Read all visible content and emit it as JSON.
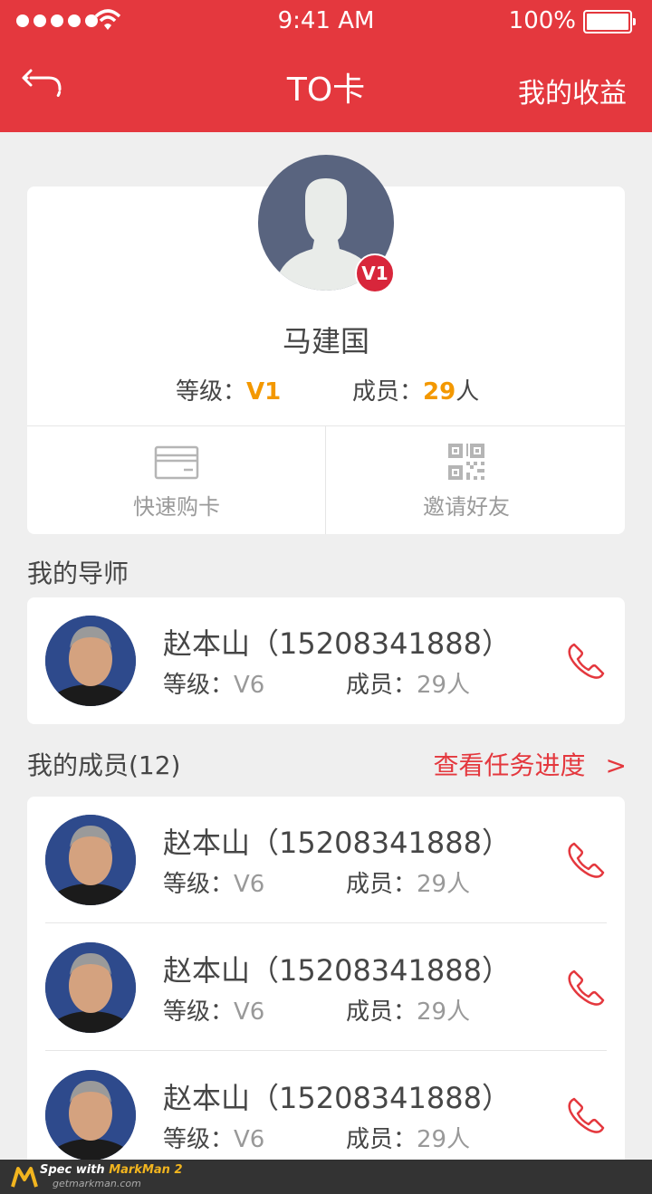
{
  "status_bar": {
    "time": "9:41 AM",
    "battery": "100%",
    "battery_level": 1.0
  },
  "nav": {
    "title": "TO卡",
    "right_action": "我的收益"
  },
  "profile": {
    "name": "马建国",
    "badge": "V1",
    "level_label": "等级：",
    "level_value": "V1",
    "members_label": "成员：",
    "members_value": "29",
    "members_unit": "人"
  },
  "actions": [
    {
      "label": "快速购卡",
      "icon": "card-icon"
    },
    {
      "label": "邀请好友",
      "icon": "qrcode-icon"
    }
  ],
  "mentor_section": {
    "title": "我的导师"
  },
  "mentor": {
    "name": "赵本山（15208341888）",
    "level_label": "等级：",
    "level_value": "V6",
    "members_label": "成员：",
    "members_value": "29人"
  },
  "members_section": {
    "title": "我的成员(12)",
    "link": "查看任务进度",
    "link_arrow": ">"
  },
  "members": [
    {
      "name": "赵本山（15208341888）",
      "level_label": "等级：",
      "level_value": "V6",
      "members_label": "成员：",
      "members_value": "29人"
    },
    {
      "name": "赵本山（15208341888）",
      "level_label": "等级：",
      "level_value": "V6",
      "members_label": "成员：",
      "members_value": "29人"
    },
    {
      "name": "赵本山（15208341888）",
      "level_label": "等级：",
      "level_value": "V6",
      "members_label": "成员：",
      "members_value": "29人"
    }
  ],
  "footer": {
    "spec_with": "Spec with ",
    "brand": "MarkMan 2",
    "site": "getmarkman.com"
  },
  "colors": {
    "primary": "#e4383e",
    "accent": "#f39800",
    "text": "#464646",
    "muted": "#999999"
  }
}
